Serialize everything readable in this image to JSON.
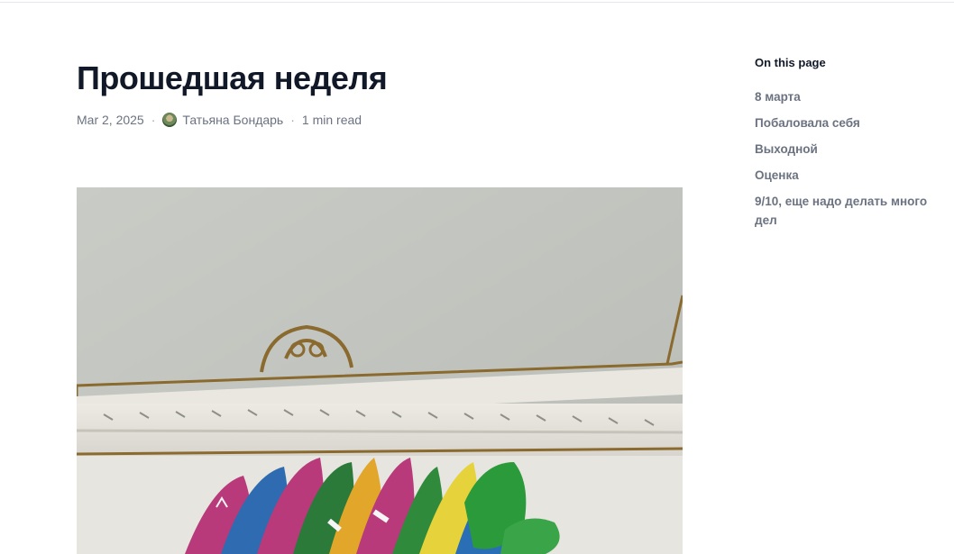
{
  "article": {
    "title": "Прошедшая неделя",
    "date": "Mar 2, 2025",
    "author": "Татьяна Бондарь",
    "read_time": "1 min read",
    "separator": "·"
  },
  "toc": {
    "title": "On this page",
    "items": [
      "8 марта",
      "Побаловала себя",
      "Выходной",
      "Оценка",
      "9/10, еще надо делать много дел"
    ]
  }
}
